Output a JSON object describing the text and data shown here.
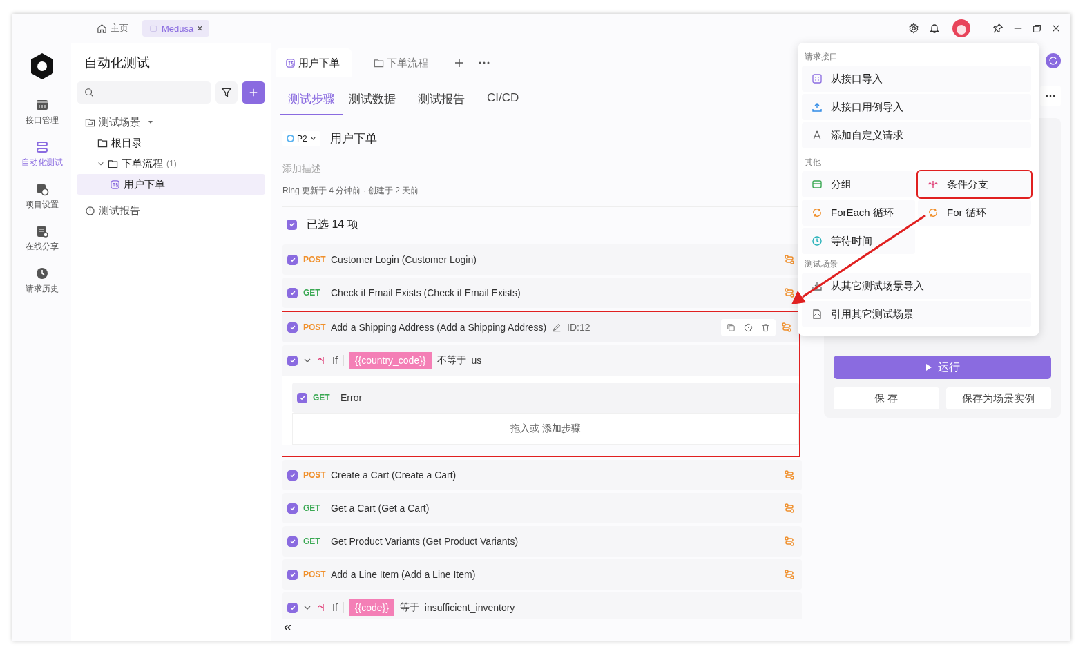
{
  "titlebar": {
    "tabs": [
      {
        "label": "主页",
        "kind": "home",
        "selected": false
      },
      {
        "label": "Medusa",
        "kind": "project",
        "selected": true,
        "close": "×"
      }
    ]
  },
  "nav": [
    {
      "label": "接口管理",
      "kind": "api",
      "selected": false
    },
    {
      "label": "自动化测试",
      "kind": "auto",
      "selected": true
    },
    {
      "label": "项目设置",
      "kind": "settings",
      "selected": false
    },
    {
      "label": "在线分享",
      "kind": "share",
      "selected": false
    },
    {
      "label": "请求历史",
      "kind": "history",
      "selected": false
    }
  ],
  "sidebar": {
    "title": "自动化测试",
    "tree": [
      {
        "label": "测试场景",
        "kind": "scenes",
        "expanded": true,
        "children": [
          {
            "label": "根目录",
            "kind": "folder",
            "selected": false
          },
          {
            "label": "下单流程",
            "kind": "folder",
            "count": "(1)",
            "expanded": true,
            "selected": false,
            "children": [
              {
                "label": "用户下单",
                "kind": "case",
                "selected": true
              }
            ]
          }
        ]
      },
      {
        "label": "测试报告",
        "kind": "report"
      }
    ]
  },
  "doc_tabs": [
    {
      "label": "用户下单",
      "kind": "case",
      "selected": true
    },
    {
      "label": "下单流程",
      "kind": "folder",
      "selected": false
    }
  ],
  "sub_tabs": [
    {
      "label": "测试步骤",
      "selected": true
    },
    {
      "label": "测试数据",
      "selected": false
    },
    {
      "label": "测试报告",
      "selected": false
    },
    {
      "label": "CI/CD",
      "selected": false
    }
  ],
  "case": {
    "priority": "P2",
    "name": "用户下单",
    "description_placeholder": "添加描述",
    "meta": "Ring 更新于 4 分钟前 · 创建于 2 天前"
  },
  "select_all": {
    "label": "已选 14 项",
    "checked": true
  },
  "steps": [
    {
      "kind": "request",
      "checked": true,
      "method": "POST",
      "name": "Customer Login (Customer Login)",
      "annotated": false
    },
    {
      "kind": "request",
      "checked": true,
      "method": "GET",
      "name": "Check if Email Exists (Check if Email Exists)",
      "annotated": false
    },
    {
      "kind": "request",
      "checked": true,
      "method": "POST",
      "name": "Add a Shipping Address (Add a Shipping Address)",
      "hovered": true,
      "id": "ID:12",
      "annotated": true
    },
    {
      "kind": "if",
      "checked": true,
      "expanded": true,
      "keyword": "If",
      "variable": "{{country_code}}",
      "operator": "不等于",
      "value": "us",
      "annotated": true,
      "children": [
        {
          "kind": "request",
          "checked": true,
          "method": "GET",
          "name": "Error"
        }
      ],
      "drop_hint": "拖入或 添加步骤"
    },
    {
      "kind": "request",
      "checked": true,
      "method": "POST",
      "name": "Create a Cart (Create a Cart)",
      "annotated": false
    },
    {
      "kind": "request",
      "checked": true,
      "method": "GET",
      "name": "Get a Cart (Get a Cart)",
      "annotated": false
    },
    {
      "kind": "request",
      "checked": true,
      "method": "GET",
      "name": "Get Product Variants (Get Product Variants)",
      "annotated": false
    },
    {
      "kind": "request",
      "checked": true,
      "method": "POST",
      "name": "Add a Line Item (Add a Line Item)",
      "annotated": false
    },
    {
      "kind": "if",
      "checked": true,
      "expanded": true,
      "keyword": "If",
      "variable": "{{code}}",
      "operator": "等于",
      "value": "insufficient_inventory",
      "annotated": false
    }
  ],
  "collapse": "«",
  "right_panel": {
    "run": "运行",
    "save": "保 存",
    "save_as": "保存为场景实例"
  },
  "menu": {
    "sections": [
      {
        "title": "请求接口",
        "kind": "list",
        "items": [
          {
            "label": "从接口导入",
            "kind": "api",
            "annotated": false
          },
          {
            "label": "从接口用例导入",
            "kind": "case",
            "annotated": false
          },
          {
            "label": "添加自定义请求",
            "kind": "custom",
            "annotated": false
          }
        ]
      },
      {
        "title": "其他",
        "kind": "grid",
        "items": [
          {
            "label": "分组",
            "kind": "group",
            "annotated": false
          },
          {
            "label": "条件分支",
            "kind": "branch",
            "annotated": true
          },
          {
            "label": "ForEach 循环",
            "kind": "foreach",
            "annotated": false
          },
          {
            "label": "For 循环",
            "kind": "for",
            "annotated": false
          },
          {
            "label": "等待时间",
            "kind": "wait",
            "annotated": false
          }
        ]
      },
      {
        "title": "测试场景",
        "kind": "list",
        "items": [
          {
            "label": "从其它测试场景导入",
            "kind": "import",
            "annotated": false
          },
          {
            "label": "引用其它测试场景",
            "kind": "ref",
            "annotated": false
          }
        ]
      }
    ]
  }
}
